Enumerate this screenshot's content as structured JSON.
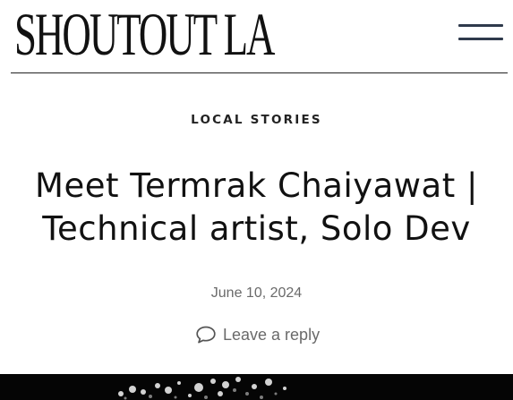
{
  "site": {
    "logo_text": "SHOUTOUT LA",
    "menu_icon": "hamburger-menu-icon"
  },
  "article": {
    "category": "LOCAL STORIES",
    "title_line1": "Meet Termrak Chaiyawat |",
    "title_line2": "Technical artist, Solo Dev",
    "date": "June 10, 2024",
    "reply_icon": "comment-bubble-icon",
    "reply_label": "Leave a reply"
  },
  "colors": {
    "text": "#111111",
    "meta": "#6a6a6a",
    "menu_bars": "#2f3a4c",
    "hero_bg": "#050505"
  }
}
